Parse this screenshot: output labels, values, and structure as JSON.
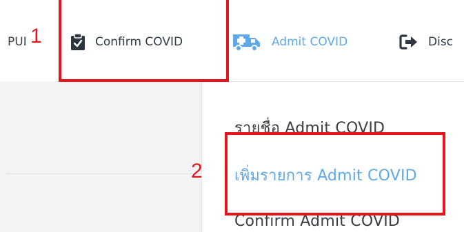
{
  "nav": {
    "pui_label": "PUI",
    "confirm_label": "Confirm COVID",
    "admit_label": "Admit COVID",
    "discharge_label": "Disc",
    "active_color": "#5fa9e8",
    "icons": {
      "confirm": "clipboard-check-icon",
      "admit": "ambulance-icon",
      "discharge": "sign-out-icon"
    }
  },
  "menu": {
    "items": [
      {
        "label": "รายชื่อ Admit COVID"
      },
      {
        "label": "เพิ่มรายการ Admit COVID"
      },
      {
        "label": "Confirm Admit COVID"
      }
    ]
  },
  "annotations": {
    "label_1": "1",
    "label_2": "2",
    "color": "#e8141b"
  }
}
